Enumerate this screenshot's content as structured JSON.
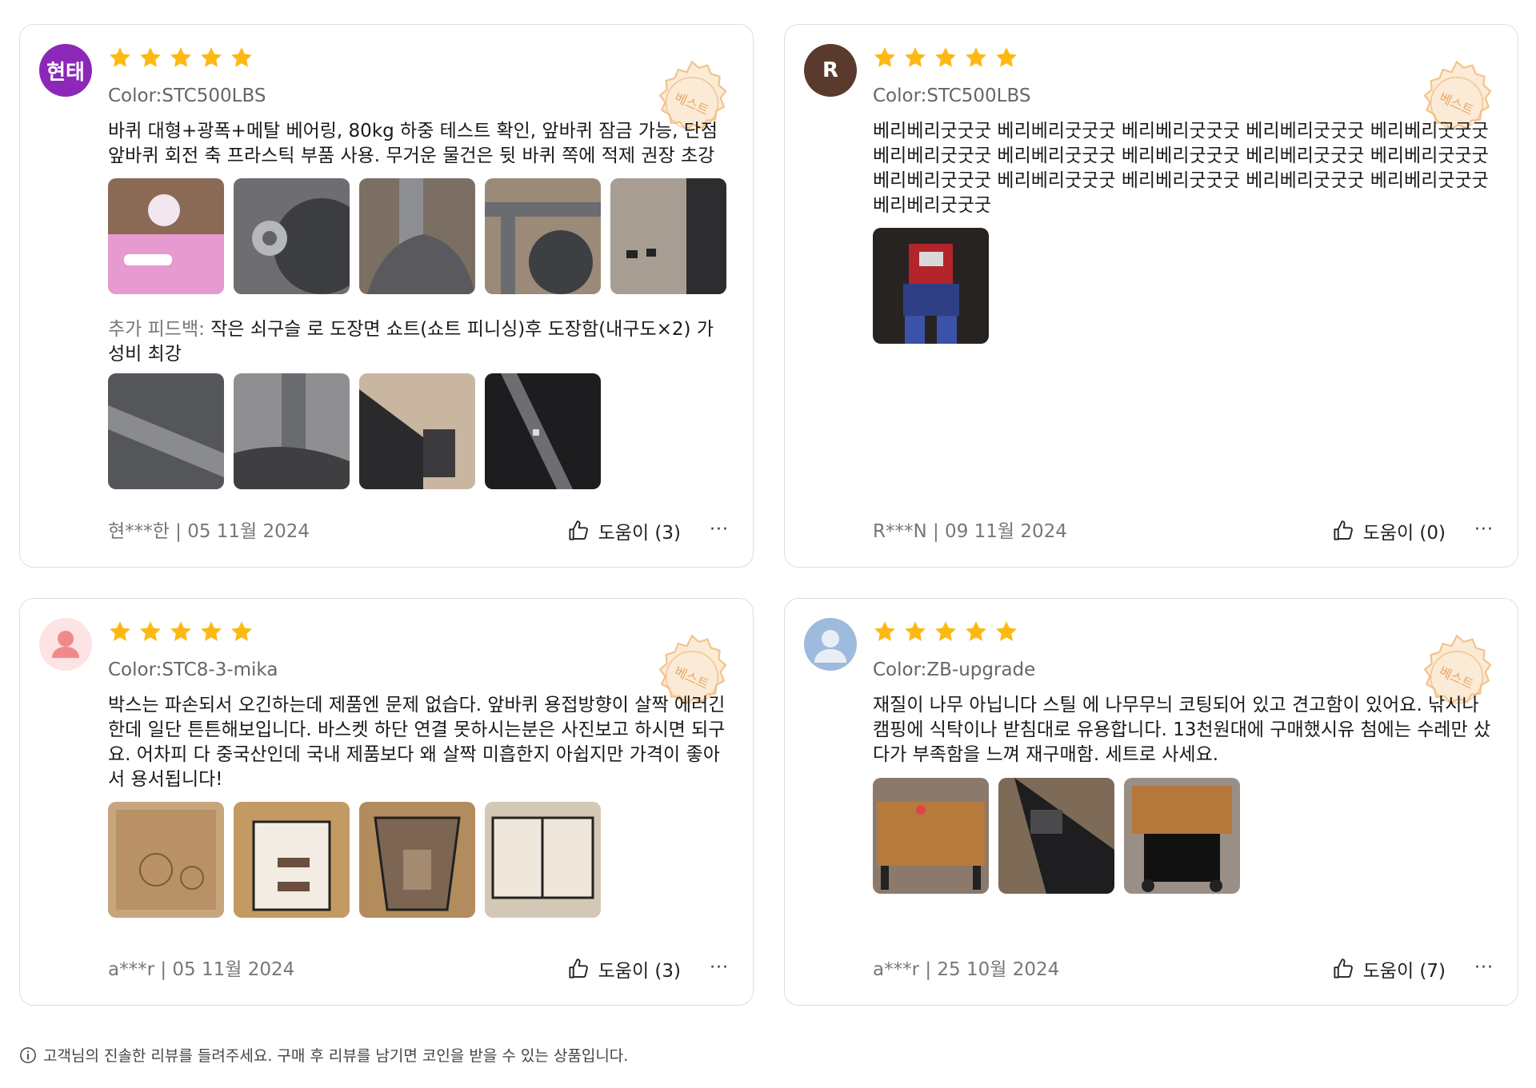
{
  "reviews": [
    {
      "avatar_text": "현태",
      "avatar_color": "#8c27b8",
      "color_option": "Color:STC500LBS",
      "badge_text": "베스트",
      "text": "바퀴 대형+광폭+메탈 베어링, 80kg 하중 테스트 확인, 앞바퀴 잠금 가능, 단점 앞바퀴 회전 축 프라스틱 부품 사용. 무거운 물건은 뒷 바퀴 쪽에 적제 권장 초강추",
      "feedback_label": "추가 피드백:",
      "feedback_text": "작은 쇠구슬 로 도장면 쇼트(쇼트 피니싱)후 도장함(내구도×2) 가성비 최강",
      "author_date": "현***한 | 05 11월 2024",
      "helpful_label": "도움이 (3)",
      "more": "···"
    },
    {
      "avatar_text": "R",
      "avatar_color": "#5b3a2e",
      "color_option": "Color:STC500LBS",
      "badge_text": "베스트",
      "text": "베리베리굿굿굿 베리베리굿굿굿 베리베리굿굿굿 베리베리굿굿굿 베리베리굿굿굿 베리베리굿굿굿 베리베리굿굿굿 베리베리굿굿굿 베리베리굿굿굿 베리베리굿굿굿 베리베리굿굿굿 베리베리굿굿굿 베리베리굿굿굿 베리베리굿굿굿 베리베리굿굿굿 베리베리굿굿굿",
      "author_date": "R***N | 09 11월 2024",
      "helpful_label": "도움이 (0)",
      "more": "···"
    },
    {
      "avatar_icon": "user-icon",
      "avatar_color": "#fde3e3",
      "color_option": "Color:STC8-3-mika",
      "badge_text": "베스트",
      "text": "박스는 파손되서 오긴하는데 제품엔 문제 없습다. 앞바퀴 용접방향이 살짝 에러긴한데 일단 튼튼해보입니다. 바스켓 하단 연결 못하시는분은 사진보고 하시면 되구요. 어차피 다 중국산인데 국내 제품보다 왜 살짝 미흡한지 아쉽지만 가격이 좋아서 용서됩니다!",
      "author_date": "a***r | 05 11월 2024",
      "helpful_label": "도움이 (3)",
      "more": "···"
    },
    {
      "avatar_icon": "user-icon",
      "avatar_color": "#9dbbdc",
      "color_option": "Color:ZB-upgrade",
      "badge_text": "베스트",
      "text": "재질이 나무 아닙니다 스틸 에 나무무늬 코팅되어 있고 견고함이 있어요. 낚시나 캠핑에 식탁이나 받침대로 유용합니다. 13천원대에 구매했시유 첨에는 수레만 샀다가 부족함을 느껴 재구매함. 세트로 사세요.",
      "author_date": "a***r | 25 10월 2024",
      "helpful_label": "도움이 (7)",
      "more": "···"
    }
  ],
  "footer_note": "고객님의 진솔한 리뷰를 들려주세요. 구매 후 리뷰를 남기면 코인을 받을 수 있는 상품입니다.",
  "colors": {
    "star": "#fdb913",
    "badge": "#f2b877"
  }
}
